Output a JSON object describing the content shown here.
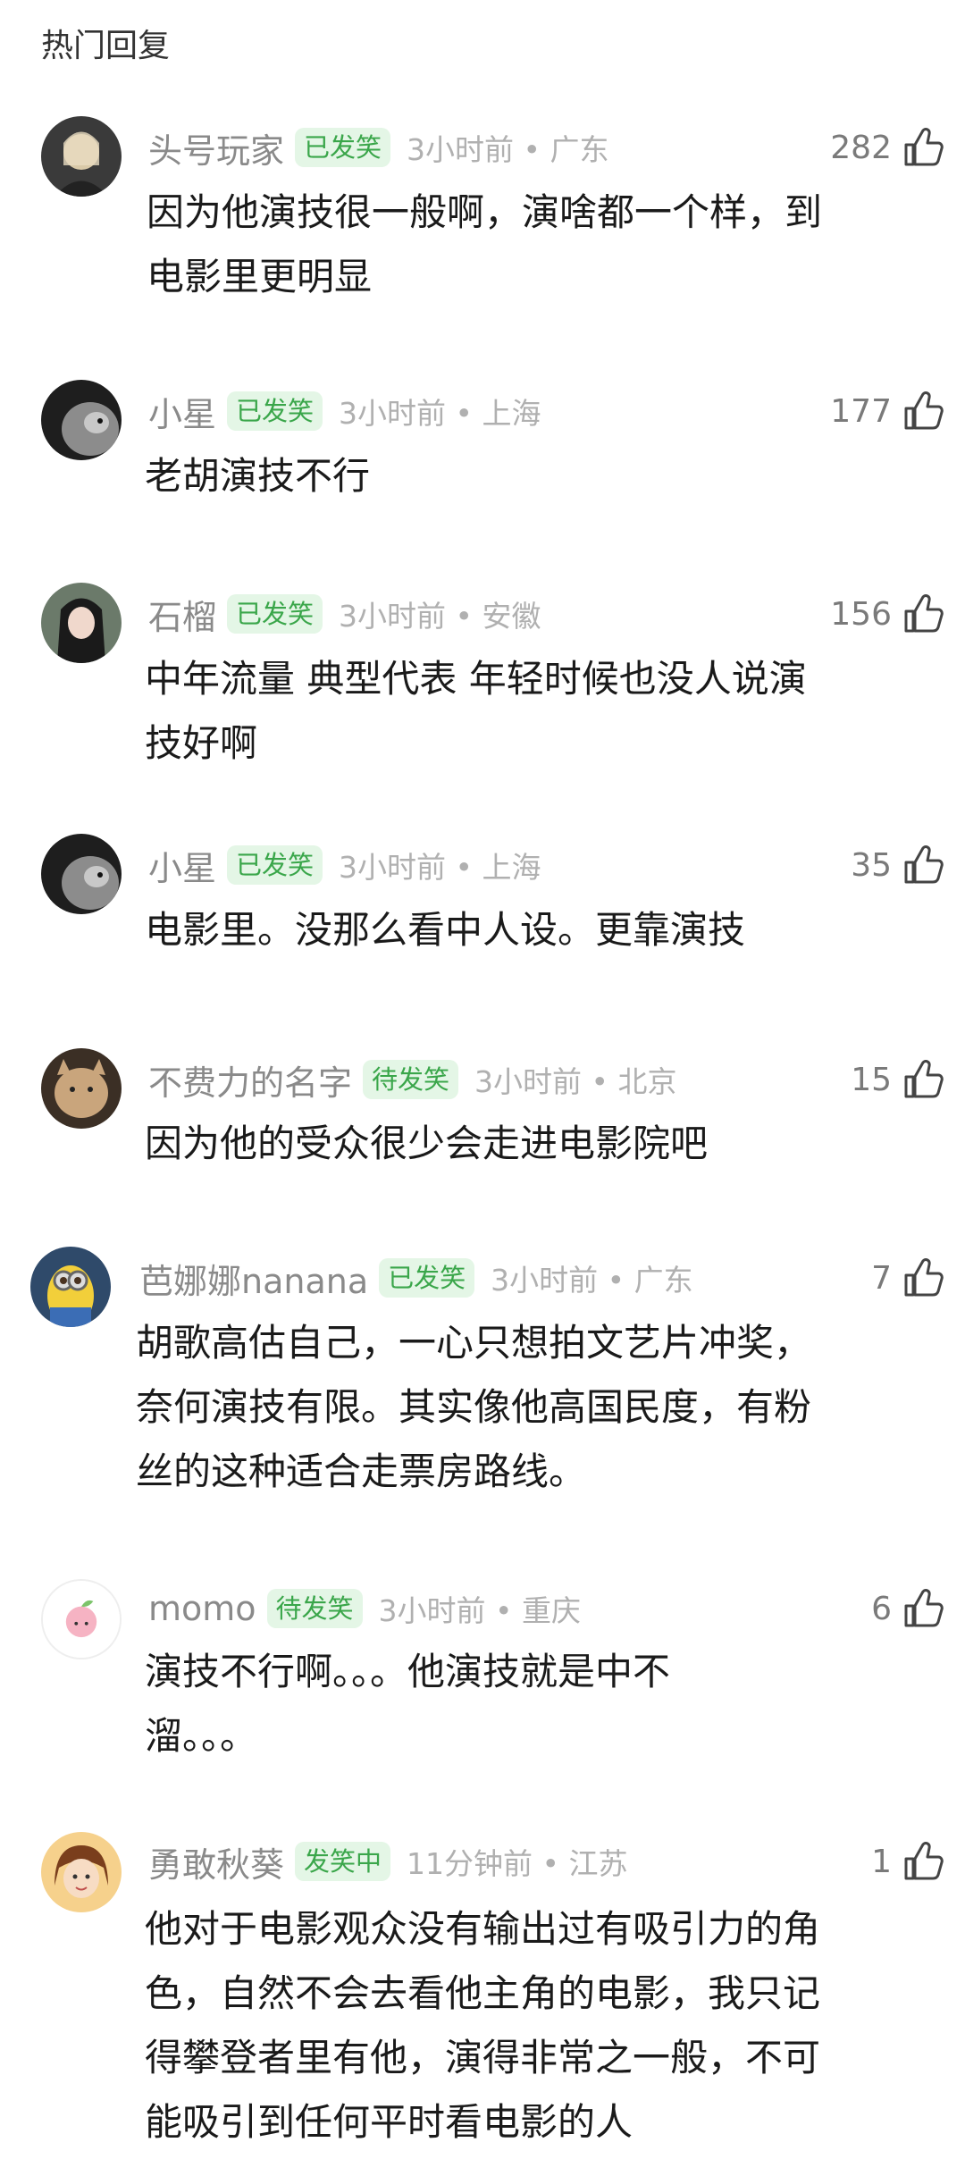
{
  "header": {
    "title": "热门回复"
  },
  "comments": [
    {
      "name": "头号玩家",
      "badge": "已发笑",
      "time": "3小时前 • 广东",
      "likes": "282",
      "text": "因为他演技很一般啊，演啥都一个样，到\n电影里更明显",
      "avatar_color": "#3a3a3a"
    },
    {
      "name": "小星",
      "badge": "已发笑",
      "time": "3小时前 • 上海",
      "likes": "177",
      "text": "老胡演技不行",
      "avatar_color": "#5c5c5c"
    },
    {
      "name": "石榴",
      "badge": "已发笑",
      "time": "3小时前 • 安徽",
      "likes": "156",
      "text": "中年流量 典型代表 年轻时候也没人说演\n技好啊",
      "avatar_color": "#4d5a4a"
    },
    {
      "name": "小星",
      "badge": "已发笑",
      "time": "3小时前 • 上海",
      "likes": "35",
      "text": "电影里。没那么看中人设。更靠演技",
      "avatar_color": "#5c5c5c"
    },
    {
      "name": "不费力的名字",
      "badge": "待发笑",
      "time": "3小时前 • 北京",
      "likes": "15",
      "text": "因为他的受众很少会走进电影院吧",
      "avatar_color": "#b49877"
    },
    {
      "name": "芭娜娜nanana",
      "badge": "已发笑",
      "time": "3小时前 • 广东",
      "likes": "7",
      "text": "胡歌高估自己，一心只想拍文艺片冲奖，\n奈何演技有限。其实像他高国民度，有粉\n丝的这种适合走票房路线。",
      "avatar_color": "#e8c23a"
    },
    {
      "name": "momo",
      "badge": "待发笑",
      "time": "3小时前 • 重庆",
      "likes": "6",
      "text": "演技不行啊。。。他演技就是中不\n溜。。。",
      "avatar_color": "#f6c6cf"
    },
    {
      "name": "勇敢秋葵",
      "badge": "发笑中",
      "time": "11分钟前 • 江苏",
      "likes": "1",
      "text": "他对于电影观众没有输出过有吸引力的角\n色，自然不会去看他主角的电影，我只记\n得攀登者里有他，演得非常之一般，不可\n能吸引到任何平时看电影的人",
      "avatar_color": "#f2b46a"
    }
  ]
}
